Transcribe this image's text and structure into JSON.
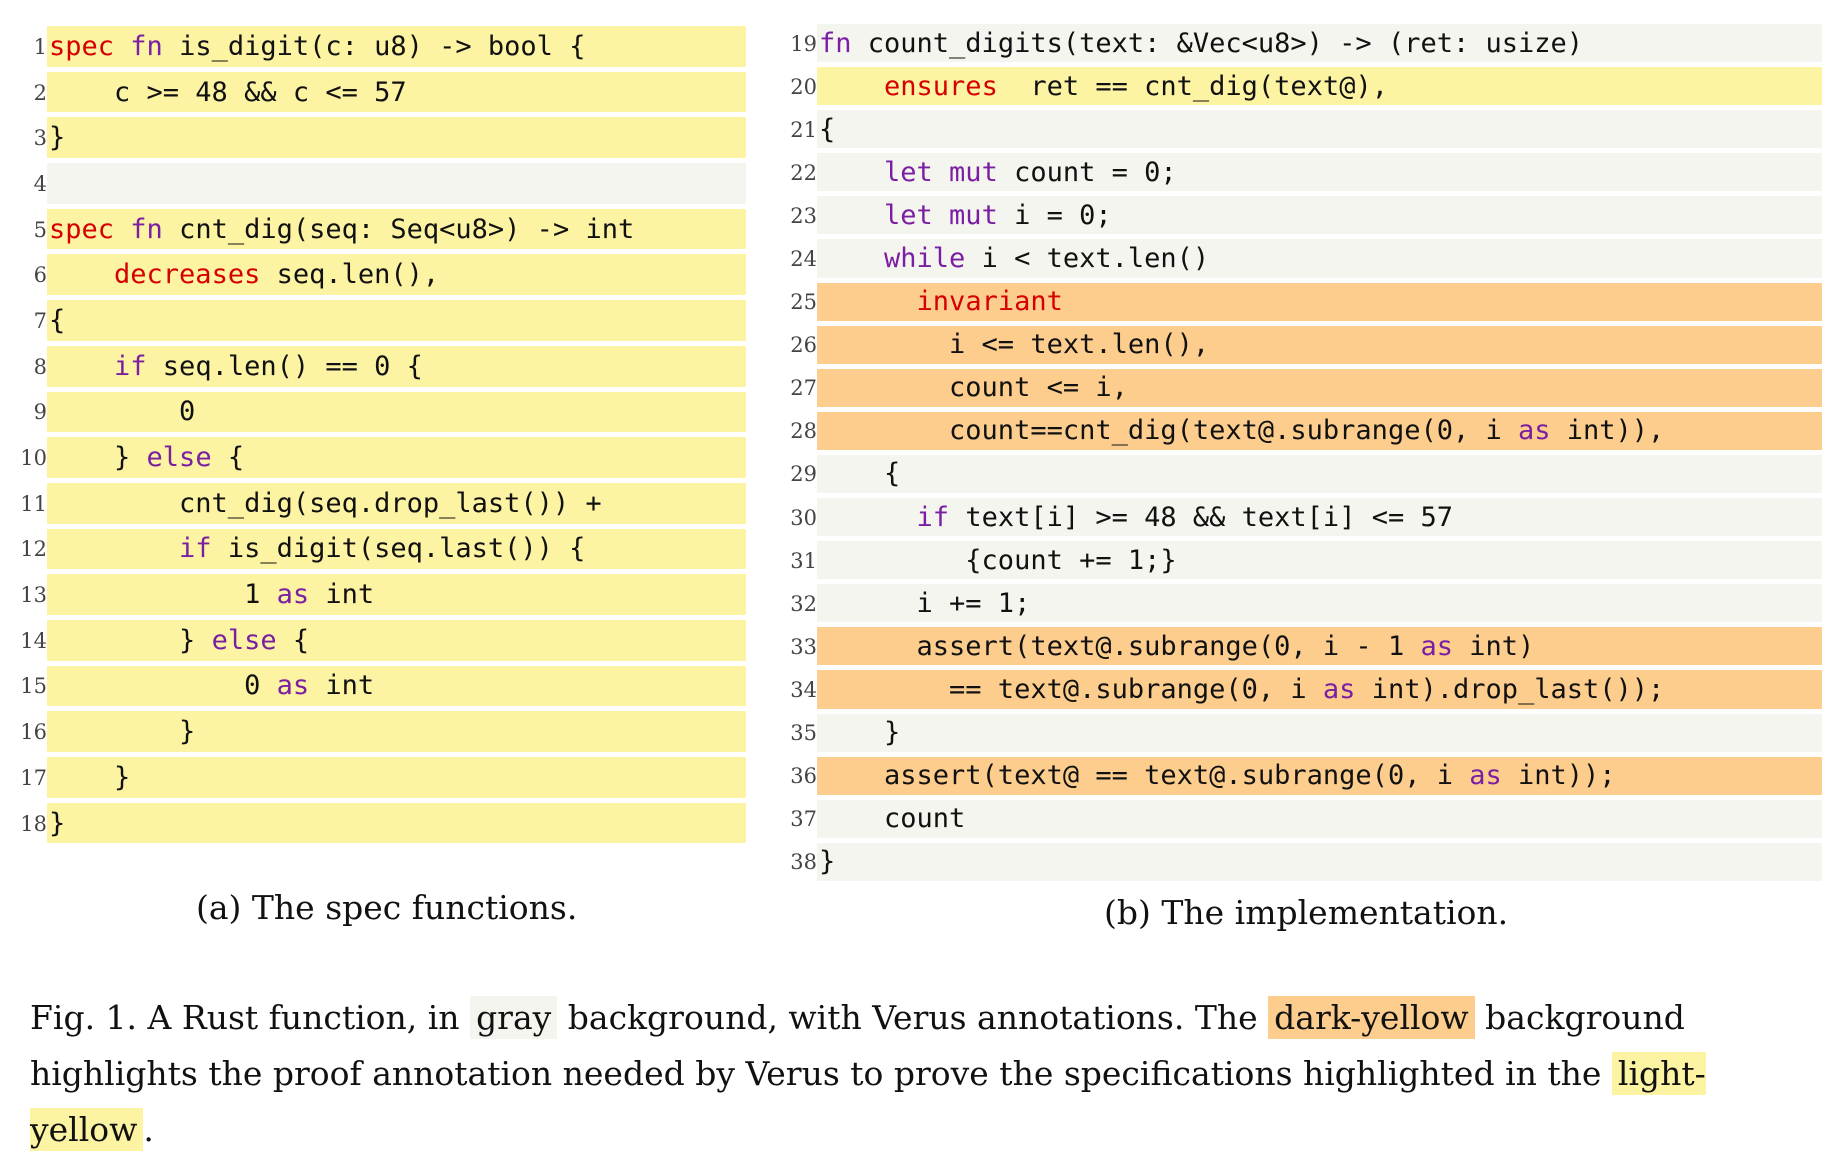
{
  "colors": {
    "gray": "#f5f5f0",
    "light_yellow": "#fcf3a3",
    "dark_yellow": "#fdcd8e",
    "keyword": "#7b1fa2",
    "spec_keyword": "#d50000"
  },
  "panel_a": {
    "caption": "(a) The spec functions.",
    "lines": [
      {
        "n": "1",
        "bg": "light",
        "tokens": [
          [
            "spec",
            "spec"
          ],
          [
            "sp",
            " "
          ],
          [
            "kw",
            "fn"
          ],
          [
            "t",
            " is_digit(c: u8) -> bool {"
          ]
        ]
      },
      {
        "n": "2",
        "bg": "light",
        "tokens": [
          [
            "t",
            "    c >= 48 && c <= 57"
          ]
        ]
      },
      {
        "n": "3",
        "bg": "light",
        "tokens": [
          [
            "t",
            "}"
          ]
        ]
      },
      {
        "n": "4",
        "bg": "gray",
        "tokens": [
          [
            "t",
            ""
          ]
        ]
      },
      {
        "n": "5",
        "bg": "light",
        "tokens": [
          [
            "spec",
            "spec"
          ],
          [
            "sp",
            " "
          ],
          [
            "kw",
            "fn"
          ],
          [
            "t",
            " cnt_dig(seq: Seq<u8>) -> int"
          ]
        ]
      },
      {
        "n": "6",
        "bg": "light",
        "tokens": [
          [
            "t",
            "    "
          ],
          [
            "spec",
            "decreases"
          ],
          [
            "t",
            " seq.len(),"
          ]
        ]
      },
      {
        "n": "7",
        "bg": "light",
        "tokens": [
          [
            "t",
            "{"
          ]
        ]
      },
      {
        "n": "8",
        "bg": "light",
        "tokens": [
          [
            "t",
            "    "
          ],
          [
            "kw",
            "if"
          ],
          [
            "t",
            " seq.len() == 0 {"
          ]
        ]
      },
      {
        "n": "9",
        "bg": "light",
        "tokens": [
          [
            "t",
            "        0"
          ]
        ]
      },
      {
        "n": "10",
        "bg": "light",
        "tokens": [
          [
            "t",
            "    } "
          ],
          [
            "kw",
            "else"
          ],
          [
            "t",
            " {"
          ]
        ]
      },
      {
        "n": "11",
        "bg": "light",
        "tokens": [
          [
            "t",
            "        cnt_dig(seq.drop_last()) +"
          ]
        ]
      },
      {
        "n": "12",
        "bg": "light",
        "tokens": [
          [
            "t",
            "        "
          ],
          [
            "kw",
            "if"
          ],
          [
            "t",
            " is_digit(seq.last()) {"
          ]
        ]
      },
      {
        "n": "13",
        "bg": "light",
        "tokens": [
          [
            "t",
            "            1 "
          ],
          [
            "kw",
            "as"
          ],
          [
            "t",
            " int"
          ]
        ]
      },
      {
        "n": "14",
        "bg": "light",
        "tokens": [
          [
            "t",
            "        } "
          ],
          [
            "kw",
            "else"
          ],
          [
            "t",
            " {"
          ]
        ]
      },
      {
        "n": "15",
        "bg": "light",
        "tokens": [
          [
            "t",
            "            0 "
          ],
          [
            "kw",
            "as"
          ],
          [
            "t",
            " int"
          ]
        ]
      },
      {
        "n": "16",
        "bg": "light",
        "tokens": [
          [
            "t",
            "        }"
          ]
        ]
      },
      {
        "n": "17",
        "bg": "light",
        "tokens": [
          [
            "t",
            "    }"
          ]
        ]
      },
      {
        "n": "18",
        "bg": "light",
        "tokens": [
          [
            "t",
            "}"
          ]
        ]
      }
    ]
  },
  "panel_b": {
    "caption": "(b) The implementation.",
    "lines": [
      {
        "n": "19",
        "bg": "gray",
        "tokens": [
          [
            "kw",
            "fn"
          ],
          [
            "t",
            " count_digits(text: &Vec<u8>) -> (ret: usize)"
          ]
        ]
      },
      {
        "n": "20",
        "bg": "light",
        "tokens": [
          [
            "t",
            "    "
          ],
          [
            "spec",
            "ensures"
          ],
          [
            "t",
            "  ret == cnt_dig(text@),"
          ]
        ]
      },
      {
        "n": "21",
        "bg": "gray",
        "tokens": [
          [
            "t",
            "{"
          ]
        ]
      },
      {
        "n": "22",
        "bg": "gray",
        "tokens": [
          [
            "t",
            "    "
          ],
          [
            "kw",
            "let mut"
          ],
          [
            "t",
            " count = 0;"
          ]
        ]
      },
      {
        "n": "23",
        "bg": "gray",
        "tokens": [
          [
            "t",
            "    "
          ],
          [
            "kw",
            "let mut"
          ],
          [
            "t",
            " i = 0;"
          ]
        ]
      },
      {
        "n": "24",
        "bg": "gray",
        "tokens": [
          [
            "t",
            "    "
          ],
          [
            "kw",
            "while"
          ],
          [
            "t",
            " i < text.len()"
          ]
        ]
      },
      {
        "n": "25",
        "bg": "dark",
        "tokens": [
          [
            "t",
            "      "
          ],
          [
            "spec",
            "invariant"
          ]
        ]
      },
      {
        "n": "26",
        "bg": "dark",
        "tokens": [
          [
            "t",
            "        i <= text.len(),"
          ]
        ]
      },
      {
        "n": "27",
        "bg": "dark",
        "tokens": [
          [
            "t",
            "        count <= i,"
          ]
        ]
      },
      {
        "n": "28",
        "bg": "dark",
        "tokens": [
          [
            "t",
            "        count==cnt_dig(text@.subrange(0, i "
          ],
          [
            "kw",
            "as"
          ],
          [
            "t",
            " int)),"
          ]
        ]
      },
      {
        "n": "29",
        "bg": "gray",
        "tokens": [
          [
            "t",
            "    {"
          ]
        ]
      },
      {
        "n": "30",
        "bg": "gray",
        "tokens": [
          [
            "t",
            "      "
          ],
          [
            "kw",
            "if"
          ],
          [
            "t",
            " text[i] >= 48 && text[i] <= 57"
          ]
        ]
      },
      {
        "n": "31",
        "bg": "gray",
        "tokens": [
          [
            "t",
            "         {count += 1;}"
          ]
        ]
      },
      {
        "n": "32",
        "bg": "gray",
        "tokens": [
          [
            "t",
            "      i += 1;"
          ]
        ]
      },
      {
        "n": "33",
        "bg": "dark",
        "tokens": [
          [
            "t",
            "      assert(text@.subrange(0, i - 1 "
          ],
          [
            "kw",
            "as"
          ],
          [
            "t",
            " int)"
          ]
        ]
      },
      {
        "n": "34",
        "bg": "dark",
        "tokens": [
          [
            "t",
            "        == text@.subrange(0, i "
          ],
          [
            "kw",
            "as"
          ],
          [
            "t",
            " int).drop_last());"
          ]
        ]
      },
      {
        "n": "35",
        "bg": "gray",
        "tokens": [
          [
            "t",
            "    }"
          ]
        ]
      },
      {
        "n": "36",
        "bg": "dark",
        "tokens": [
          [
            "t",
            "    assert(text@ == text@.subrange(0, i "
          ],
          [
            "kw",
            "as"
          ],
          [
            "t",
            " int));"
          ]
        ]
      },
      {
        "n": "37",
        "bg": "gray",
        "tokens": [
          [
            "t",
            "    count"
          ]
        ]
      },
      {
        "n": "38",
        "bg": "gray",
        "tokens": [
          [
            "t",
            "}"
          ]
        ]
      }
    ]
  },
  "figure_caption": {
    "p1": "Fig. 1.  A Rust function, in ",
    "h1": "gray",
    "p2": " background, with Verus annotations. The ",
    "h2": "dark-yellow",
    "p3": " background highlights the proof annotation needed by Verus to prove the specifications highlighted in the ",
    "h3": "light-yellow",
    "p4": "."
  }
}
